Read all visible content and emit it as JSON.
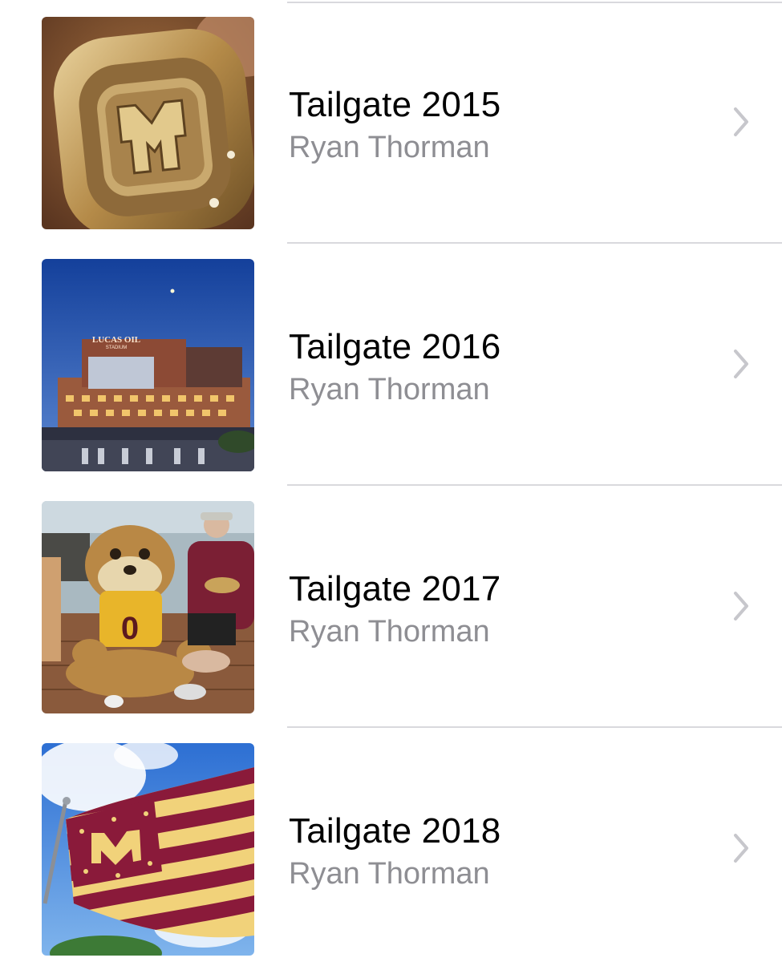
{
  "items": [
    {
      "title": "Tailgate 2015",
      "subtitle": "Ryan Thorman",
      "thumbnail": "championship-ring-photo",
      "accessory": "chevron-right-icon"
    },
    {
      "title": "Tailgate 2016",
      "subtitle": "Ryan Thorman",
      "thumbnail": "stadium-night-photo",
      "thumbnail_text": [
        "LUCAS OIL",
        "STADIUM"
      ],
      "accessory": "chevron-right-icon"
    },
    {
      "title": "Tailgate 2017",
      "subtitle": "Ryan Thorman",
      "thumbnail": "mascot-photo",
      "accessory": "chevron-right-icon"
    },
    {
      "title": "Tailgate 2018",
      "subtitle": "Ryan Thorman",
      "thumbnail": "flag-photo",
      "accessory": "chevron-right-icon"
    }
  ],
  "colors": {
    "title": "#000000",
    "subtitle": "#8e8e93",
    "separator": "#d9d9dd",
    "chevron": "#c7c7cc",
    "background": "#ffffff"
  }
}
